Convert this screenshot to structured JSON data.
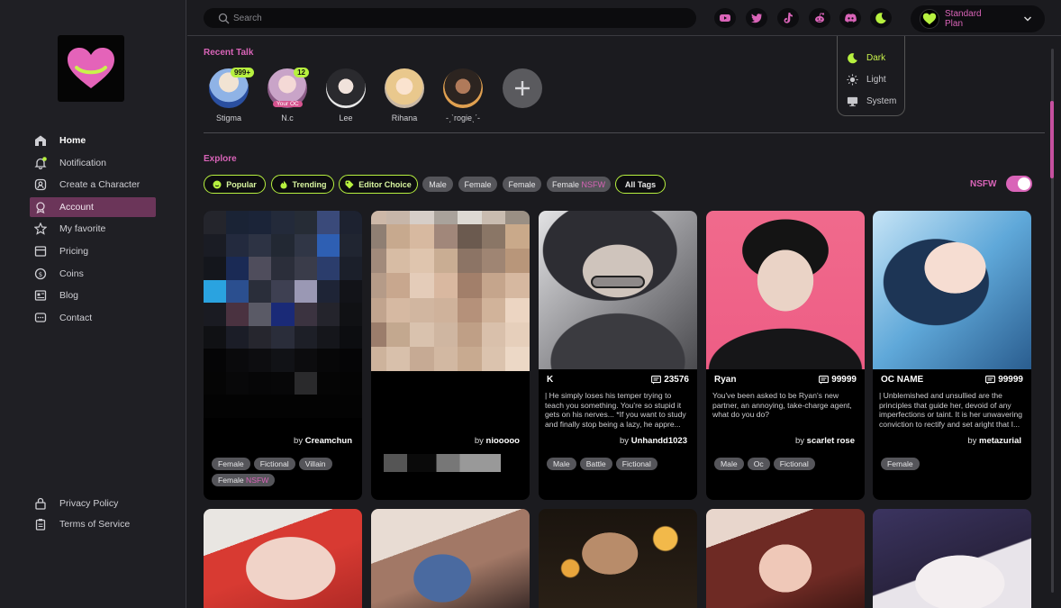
{
  "search": {
    "placeholder": "Search"
  },
  "sidebar": {
    "items": [
      {
        "label": "Home",
        "icon": "home-icon"
      },
      {
        "label": "Notification",
        "icon": "bell-icon"
      },
      {
        "label": "Create a Character",
        "icon": "create-character-icon"
      },
      {
        "label": "Account",
        "icon": "account-icon"
      },
      {
        "label": "My favorite",
        "icon": "star-icon"
      },
      {
        "label": "Pricing",
        "icon": "pricing-icon"
      },
      {
        "label": "Coins",
        "icon": "coin-icon"
      },
      {
        "label": "Blog",
        "icon": "blog-icon"
      },
      {
        "label": "Contact",
        "icon": "chat-icon"
      }
    ],
    "footer": [
      {
        "label": "Privacy Policy",
        "icon": "lock-icon"
      },
      {
        "label": "Terms of Service",
        "icon": "clipboard-icon"
      }
    ]
  },
  "header": {
    "social": [
      "youtube-icon",
      "twitter-icon",
      "tiktok-icon",
      "reddit-icon",
      "discord-icon",
      "moon-icon"
    ],
    "plan": "Standard Plan"
  },
  "theme_menu": [
    "Dark",
    "Light",
    "System"
  ],
  "recent": {
    "title": "Recent Talk",
    "items": [
      {
        "name": "Stigma",
        "badge": "999+"
      },
      {
        "name": "N.c",
        "badge": "12",
        "tag": "Your OC"
      },
      {
        "name": "Lee"
      },
      {
        "name": "Rihana"
      },
      {
        "name": "-ˏˋrogieˎˊ-"
      }
    ]
  },
  "explore": {
    "title": "Explore",
    "filters": [
      "Popular",
      "Trending",
      "Editor Choice"
    ],
    "tags": [
      "Male",
      "Female",
      "Female"
    ],
    "nsfw_tag": {
      "base": "Female",
      "accent": "NSFW"
    },
    "all_tags": "All Tags",
    "nsfw_label": "NSFW"
  },
  "cards": [
    {
      "name": "",
      "count": "",
      "desc": "",
      "by_prefix": "by",
      "author": "Creamchun",
      "tags": [
        "Female",
        "Fictional",
        "Villain"
      ],
      "extra_tag": {
        "base": "Female",
        "accent": "NSFW"
      }
    },
    {
      "name": "",
      "count": "",
      "desc": "",
      "by_prefix": "by",
      "author": "niooooo",
      "tags": []
    },
    {
      "name": "K",
      "count": "23576",
      "desc": "| He simply loses his temper trying to teach you something. You're so stupid it gets on his nerves... *If you want to study and finally stop being a lazy, he appre...",
      "by_prefix": "by",
      "author": "Unhandd1023",
      "tags": [
        "Male",
        "Battle",
        "Fictional"
      ]
    },
    {
      "name": "Ryan",
      "count": "99999",
      "desc": "You've been asked to be Ryan's new partner, an annoying, take-charge agent, what do you do?",
      "by_prefix": "by",
      "author": "scarlet rose",
      "tags": [
        "Male",
        "Oc",
        "Fictional"
      ]
    },
    {
      "name": "OC NAME",
      "count": "99999",
      "desc": "| Unblemished and unsullied are the principles that guide her, devoid of any imperfections or taint. It is her unwavering conviction to rectify and set aright that I...",
      "by_prefix": "by",
      "author": "metazurial",
      "tags": [
        "Female"
      ]
    }
  ],
  "colors": {
    "accent_green": "#b7f13f",
    "accent_pink": "#d964b8",
    "active_nav": "#6b3559"
  }
}
